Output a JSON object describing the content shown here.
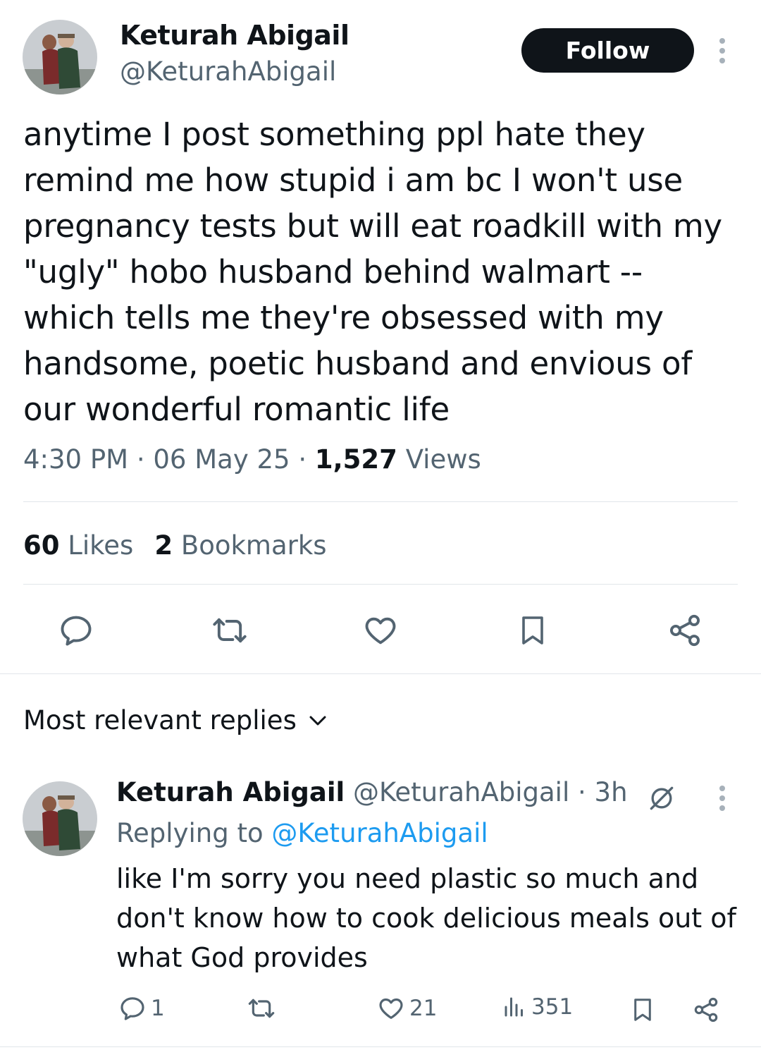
{
  "tweet": {
    "author_name": "Keturah Abigail",
    "author_handle": "@KeturahAbigail",
    "follow_label": "Follow",
    "text": "anytime I post something ppl hate they remind me how stupid i am bc I won't use pregnancy tests but will eat roadkill with my \"ugly\" hobo husband behind walmart --which tells me they're obsessed with my handsome, poetic husband and envious of our wonderful romantic life",
    "time": "4:30 PM",
    "date": "06 May 25",
    "views_count": "1,527",
    "views_label": "Views",
    "likes_count": "60",
    "likes_label": "Likes",
    "bookmarks_count": "2",
    "bookmarks_label": "Bookmarks"
  },
  "actions": {
    "icons": [
      "reply-icon",
      "retweet-icon",
      "like-icon",
      "bookmark-icon",
      "share-icon"
    ]
  },
  "replies_sort": {
    "label": "Most relevant replies"
  },
  "reply": {
    "author_name": "Keturah Abigail",
    "author_handle": "@KeturahAbigail",
    "age": "3h",
    "replying_to_label": "Replying to",
    "replying_to_handle": "@KeturahAbigail",
    "text": "like I'm sorry you need plastic so much and don't know how to cook delicious meals out of what God provides",
    "reply_count": "1",
    "like_count": "21",
    "views_count": "351"
  },
  "colors": {
    "text_primary": "#0f1419",
    "text_secondary": "#536471",
    "link": "#1d9bf0",
    "divider": "#e1e6ea"
  }
}
